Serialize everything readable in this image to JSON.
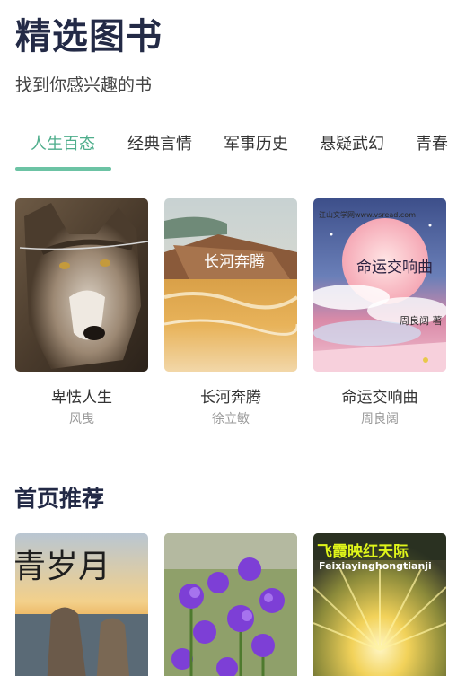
{
  "header": {
    "title": "精选图书",
    "subtitle": "找到你感兴趣的书"
  },
  "tabs": [
    {
      "label": "人生百态",
      "active": true
    },
    {
      "label": "经典言情",
      "active": false
    },
    {
      "label": "军事历史",
      "active": false
    },
    {
      "label": "悬疑武幻",
      "active": false
    },
    {
      "label": "青春",
      "active": false
    }
  ],
  "featured_books": [
    {
      "title": "卑怯人生",
      "author": "风曳"
    },
    {
      "title": "长河奔腾",
      "author": "徐立敏",
      "cover_text": "长河奔腾"
    },
    {
      "title": "命运交响曲",
      "author": "周良阔",
      "cover_text": "命运交响曲",
      "cover_site": "江山文学网www.vsread.com",
      "cover_author": "周良阔 著"
    }
  ],
  "recommend": {
    "title": "首页推荐",
    "covers": [
      {
        "cover_text": "青岁月"
      },
      {
        "cover_text": ""
      },
      {
        "cover_text": "飞霞映红天际",
        "cover_subtext": "Feixiayinghongtianji"
      }
    ]
  },
  "colors": {
    "accent": "#4fae8c",
    "indicator": "#6cc3a4",
    "title": "#232a46"
  }
}
